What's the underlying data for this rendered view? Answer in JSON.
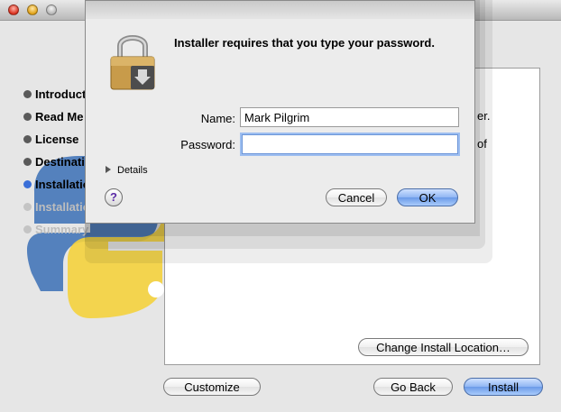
{
  "installer": {
    "steps": [
      {
        "label": "Introduction",
        "state": "done"
      },
      {
        "label": "Read Me",
        "state": "done"
      },
      {
        "label": "License",
        "state": "done"
      },
      {
        "label": "Destination Select",
        "state": "done"
      },
      {
        "label": "Installation Type",
        "state": "current"
      },
      {
        "label": "Installation",
        "state": "pending"
      },
      {
        "label": "Summary",
        "state": "pending"
      }
    ],
    "panel_text_1": "er.",
    "panel_text_2": "of",
    "change_location_label": "Change Install Location…",
    "customize_label": "Customize",
    "go_back_label": "Go Back",
    "install_label": "Install"
  },
  "dialog": {
    "headline": "Installer requires that you type your password.",
    "name_label": "Name:",
    "name_value": "Mark Pilgrim",
    "password_label": "Password:",
    "password_value": "",
    "details_label": "Details",
    "help_label": "?",
    "cancel_label": "Cancel",
    "ok_label": "OK"
  },
  "colors": {
    "default_button": "#6b9ae8",
    "focus_ring": "#9dbef0",
    "current_step_dot": "#3a6fd8"
  }
}
